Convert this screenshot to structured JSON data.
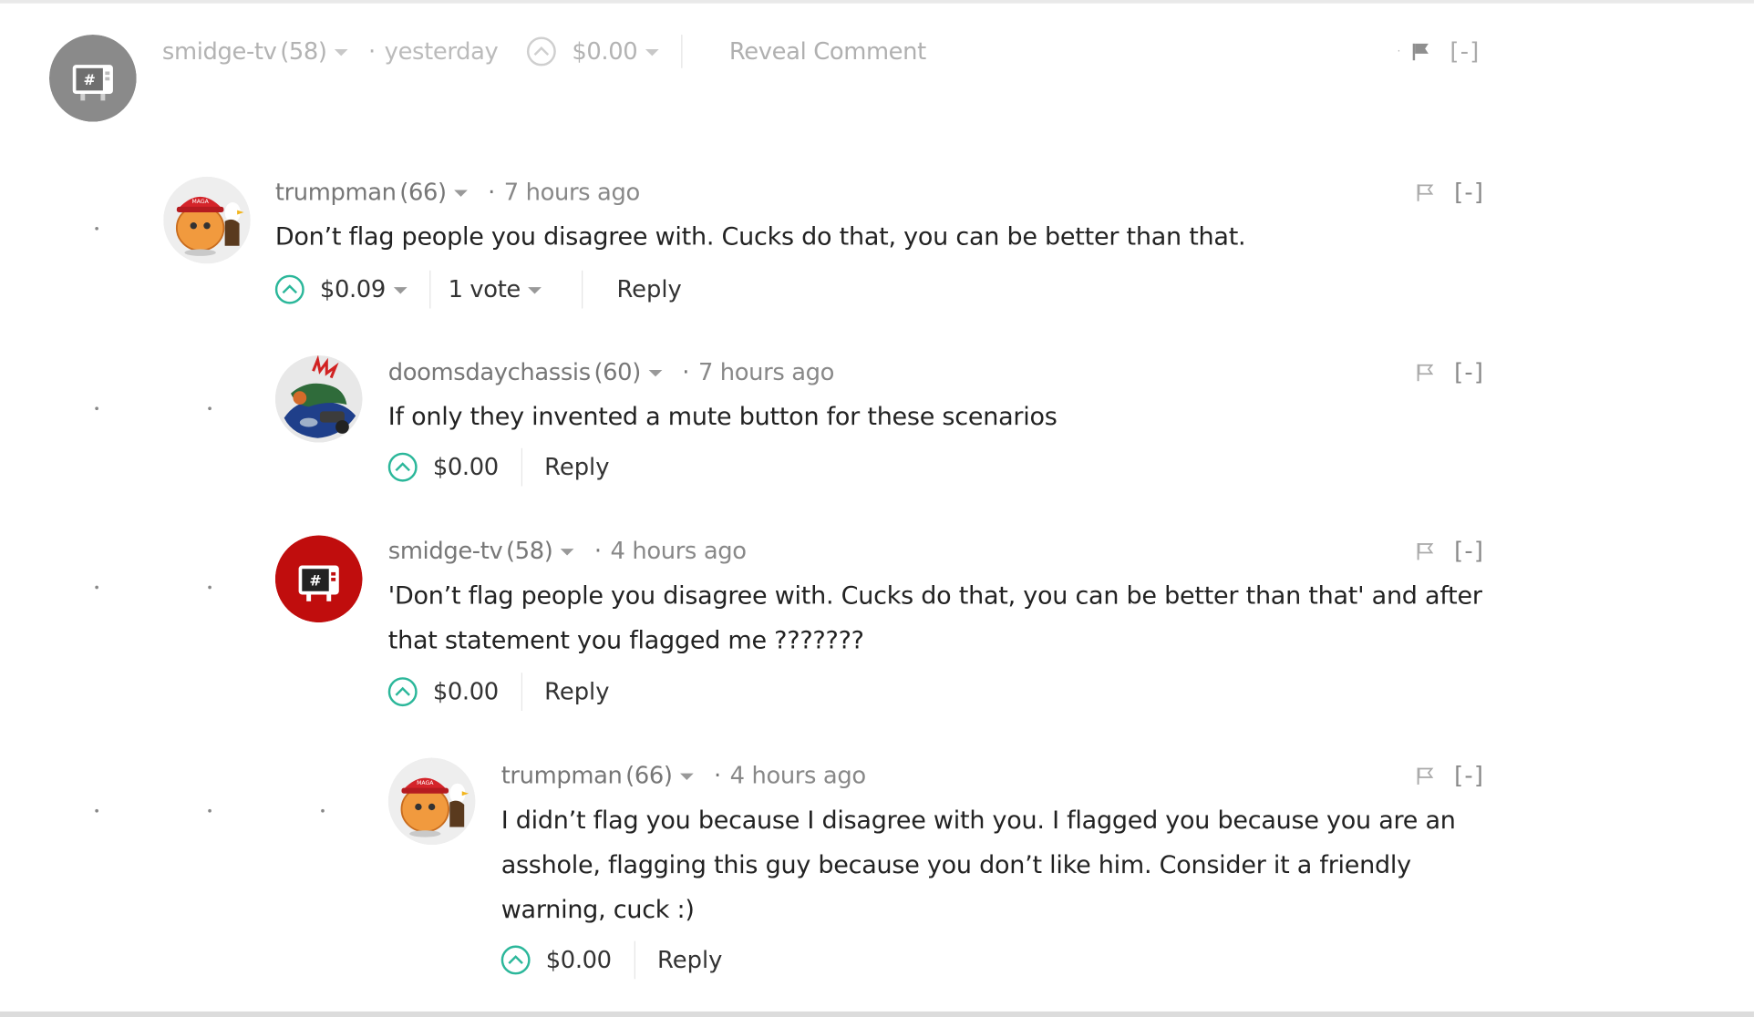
{
  "comments": [
    {
      "author": "smidge-tv",
      "rep": "(58)",
      "time": "yesterday",
      "payout": "$0.00",
      "reveal": "Reveal Comment",
      "collapse": "[-]",
      "hidden": true
    },
    {
      "author": "trumpman",
      "rep": "(66)",
      "time": "7 hours ago",
      "body": "Don’t flag people you disagree with. Cucks do that, you can be better than that.",
      "payout": "$0.09",
      "votes": "1 vote",
      "reply": "Reply",
      "collapse": "[-]"
    },
    {
      "author": "doomsdaychassis",
      "rep": "(60)",
      "time": "7 hours ago",
      "body": "If only they invented a mute button for these scenarios",
      "payout": "$0.00",
      "reply": "Reply",
      "collapse": "[-]"
    },
    {
      "author": "smidge-tv",
      "rep": "(58)",
      "time": "4 hours ago",
      "body_line1": "'Don’t flag people you disagree with. Cucks do that, you can be better than that' and after",
      "body_line2": "that statement you flagged me ???????",
      "payout": "$0.00",
      "reply": "Reply",
      "collapse": "[-]"
    },
    {
      "author": "trumpman",
      "rep": "(66)",
      "time": "4 hours ago",
      "body_line1": "I didn’t flag you because I disagree with you. I flagged you because you are an",
      "body_line2": "asshole, flagging this guy because you don’t like him. Consider it a friendly",
      "body_line3": "warning, cuck :)",
      "payout": "$0.00",
      "reply": "Reply",
      "collapse": "[-]"
    }
  ],
  "separator": "·",
  "colors": {
    "upvote": "#2bb79a",
    "text": "#222222",
    "meta": "#777777",
    "hidden_text": "#b3b3b3",
    "smidge_avatar_hidden": "#8a8a8a",
    "smidge_avatar": "#c00d0d"
  },
  "icons": [
    "upvote-chevron-icon",
    "dropdown-caret-icon",
    "flag-icon",
    "flag-filled-icon"
  ]
}
